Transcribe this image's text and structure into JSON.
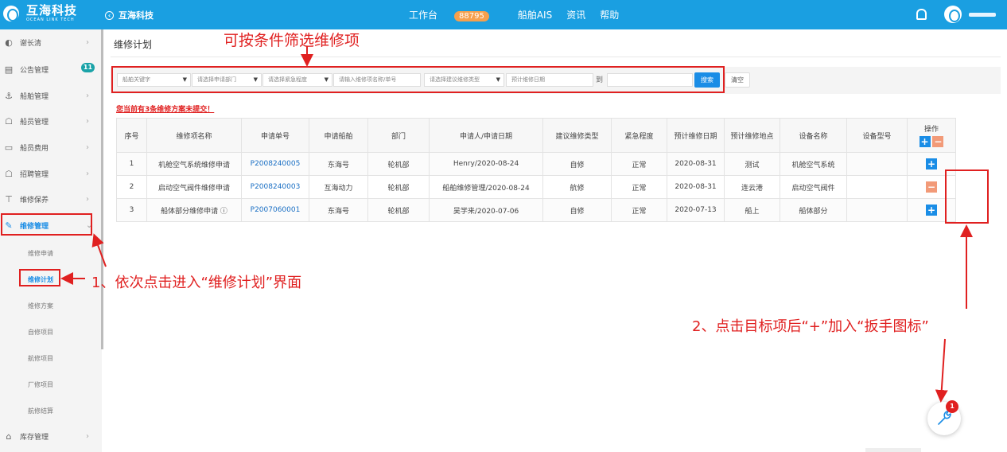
{
  "header": {
    "logo_cn": "互海科技",
    "logo_en": "OCEAN LINK TECH",
    "back_label": "互海科技",
    "nav": {
      "workbench": "工作台",
      "workbench_count": "88795",
      "ship_ais": "船舶AIS",
      "news": "资讯",
      "help": "帮助"
    }
  },
  "sidebar": {
    "user": "谢长清",
    "notice_badge": "11",
    "items": [
      {
        "label": "公告管理"
      },
      {
        "label": "船舶管理"
      },
      {
        "label": "船员管理"
      },
      {
        "label": "船员费用"
      },
      {
        "label": "招聘管理"
      },
      {
        "label": "维修保养"
      },
      {
        "label": "维修管理"
      },
      {
        "label": "库存管理"
      }
    ],
    "subitems": [
      "维修申请",
      "维修计划",
      "维修方案",
      "自修项目",
      "航修项目",
      "厂修项目",
      "航修结算"
    ]
  },
  "page": {
    "title": "维修计划",
    "filters": {
      "ship_keyword": "船舶关键字",
      "dept": "请选择申请部门",
      "urgency": "请选择紧急程度",
      "item_placeholder": "请输入维修项名称/单号",
      "repair_type": "请选择建议维修类型",
      "date_placeholder": "预计维修日期",
      "to": "到",
      "search": "搜索",
      "clear": "清空"
    },
    "warning": "您当前有3条维修方案未提交！",
    "table": {
      "headers": [
        "序号",
        "维修项名称",
        "申请单号",
        "申请船舶",
        "部门",
        "申请人/申请日期",
        "建议维修类型",
        "紧急程度",
        "预计维修日期",
        "预计维修地点",
        "设备名称",
        "设备型号",
        "操作"
      ],
      "rows": [
        {
          "no": "1",
          "name": "机舱空气系统维修申请",
          "order": "P2008240005",
          "ship": "东海号",
          "dept": "轮机部",
          "applicant": "Henry/2020-08-24",
          "type": "自修",
          "urgency": "正常",
          "date": "2020-08-31",
          "place": "测试",
          "device": "机舱空气系统",
          "model": "",
          "op": "plus"
        },
        {
          "no": "2",
          "name": "启动空气阀件维修申请",
          "order": "P2008240003",
          "ship": "互海动力",
          "dept": "轮机部",
          "applicant": "船舶维修管理/2020-08-24",
          "type": "航修",
          "urgency": "正常",
          "date": "2020-08-31",
          "place": "连云港",
          "device": "启动空气阀件",
          "model": "",
          "op": "minus"
        },
        {
          "no": "3",
          "name": "船体部分维修申请 ⓘ",
          "order": "P2007060001",
          "ship": "东海号",
          "dept": "轮机部",
          "applicant": "吴学来/2020-07-06",
          "type": "自修",
          "urgency": "正常",
          "date": "2020-07-13",
          "place": "船上",
          "device": "船体部分",
          "model": "",
          "op": "plus"
        }
      ]
    }
  },
  "annotations": {
    "filter_note": "可按条件筛选维修项",
    "step1": "1、依次点击进入“维修计划”界面",
    "step2": "2、点击目标项后“+”加入“扳手图标”"
  },
  "fab": {
    "badge": "1"
  },
  "colors": {
    "primary": "#1a9fe1",
    "annotation": "#e02020",
    "minus": "#f29a78"
  }
}
